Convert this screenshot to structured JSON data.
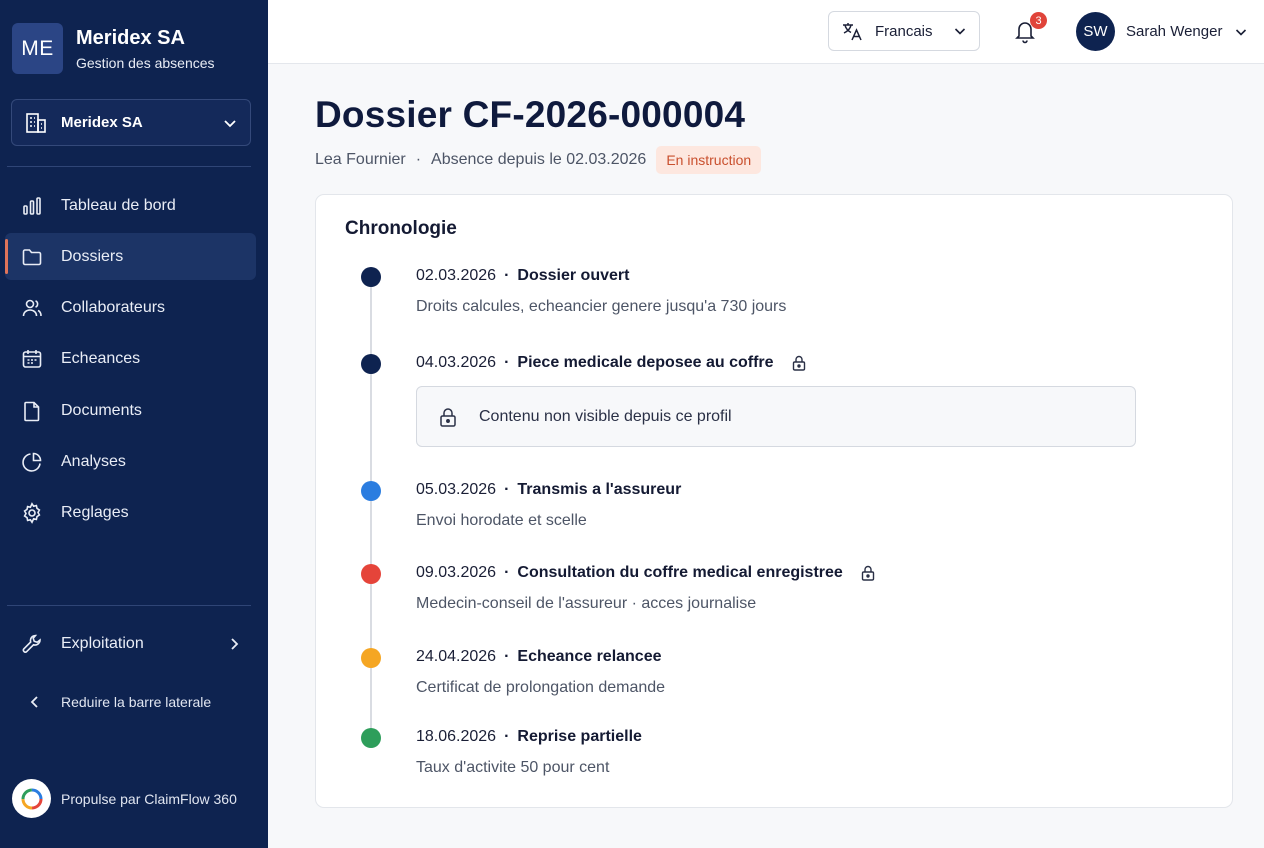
{
  "sidebar": {
    "brand": {
      "logo": "ME",
      "name": "Meridex SA",
      "subtitle": "Gestion des absences"
    },
    "org_selector": {
      "label": "Meridex SA",
      "icon": "building-icon"
    },
    "items": [
      {
        "label": "Tableau de bord",
        "icon": "bar-chart-icon"
      },
      {
        "label": "Dossiers",
        "icon": "folder-icon",
        "active": true
      },
      {
        "label": "Collaborateurs",
        "icon": "users-icon"
      },
      {
        "label": "Echeances",
        "icon": "calendar-icon"
      },
      {
        "label": "Documents",
        "icon": "file-icon"
      },
      {
        "label": "Analyses",
        "icon": "pie-chart-icon"
      },
      {
        "label": "Reglages",
        "icon": "gear-icon"
      }
    ],
    "exploitation": {
      "label": "Exploitation",
      "icon": "wrench-icon"
    },
    "collapse_label": "Reduire la barre laterale",
    "powered_by": "Propulse par ClaimFlow 360"
  },
  "topbar": {
    "language": "Francais",
    "notifications_count": "3",
    "user": {
      "initials": "SW",
      "name": "Sarah Wenger"
    }
  },
  "dossier": {
    "title": "Dossier CF-2026-000004",
    "person": "Lea Fournier",
    "absence": "Absence depuis le 02.03.2026",
    "status": "En instruction"
  },
  "timeline": {
    "title": "Chronologie",
    "events": [
      {
        "date": "02.03.2026",
        "title": "Dossier ouvert",
        "description": "Droits calcules, echeancier genere jusqu'a 730 jours",
        "color": "#0e2350",
        "locked": false
      },
      {
        "date": "04.03.2026",
        "title": "Piece medicale deposee au coffre",
        "description": "Contenu non visible depuis ce profil",
        "color": "#0e2350",
        "locked": true
      },
      {
        "date": "05.03.2026",
        "title": "Transmis a l'assureur",
        "description": "Envoi horodate et scelle",
        "color": "#2b7de0",
        "locked": false
      },
      {
        "date": "09.03.2026",
        "title": "Consultation du coffre medical enregistree",
        "description": "Medecin-conseil de l'assureur · acces journalise",
        "color": "#e5443a",
        "locked": true
      },
      {
        "date": "24.04.2026",
        "title": "Echeance relancee",
        "description": "Certificat de prolongation demande",
        "color": "#f5a623",
        "locked": false
      },
      {
        "date": "18.06.2026",
        "title": "Reprise partielle",
        "description": "Taux d'activite 50 pour cent",
        "color": "#2e9e5b",
        "locked": false
      }
    ]
  }
}
